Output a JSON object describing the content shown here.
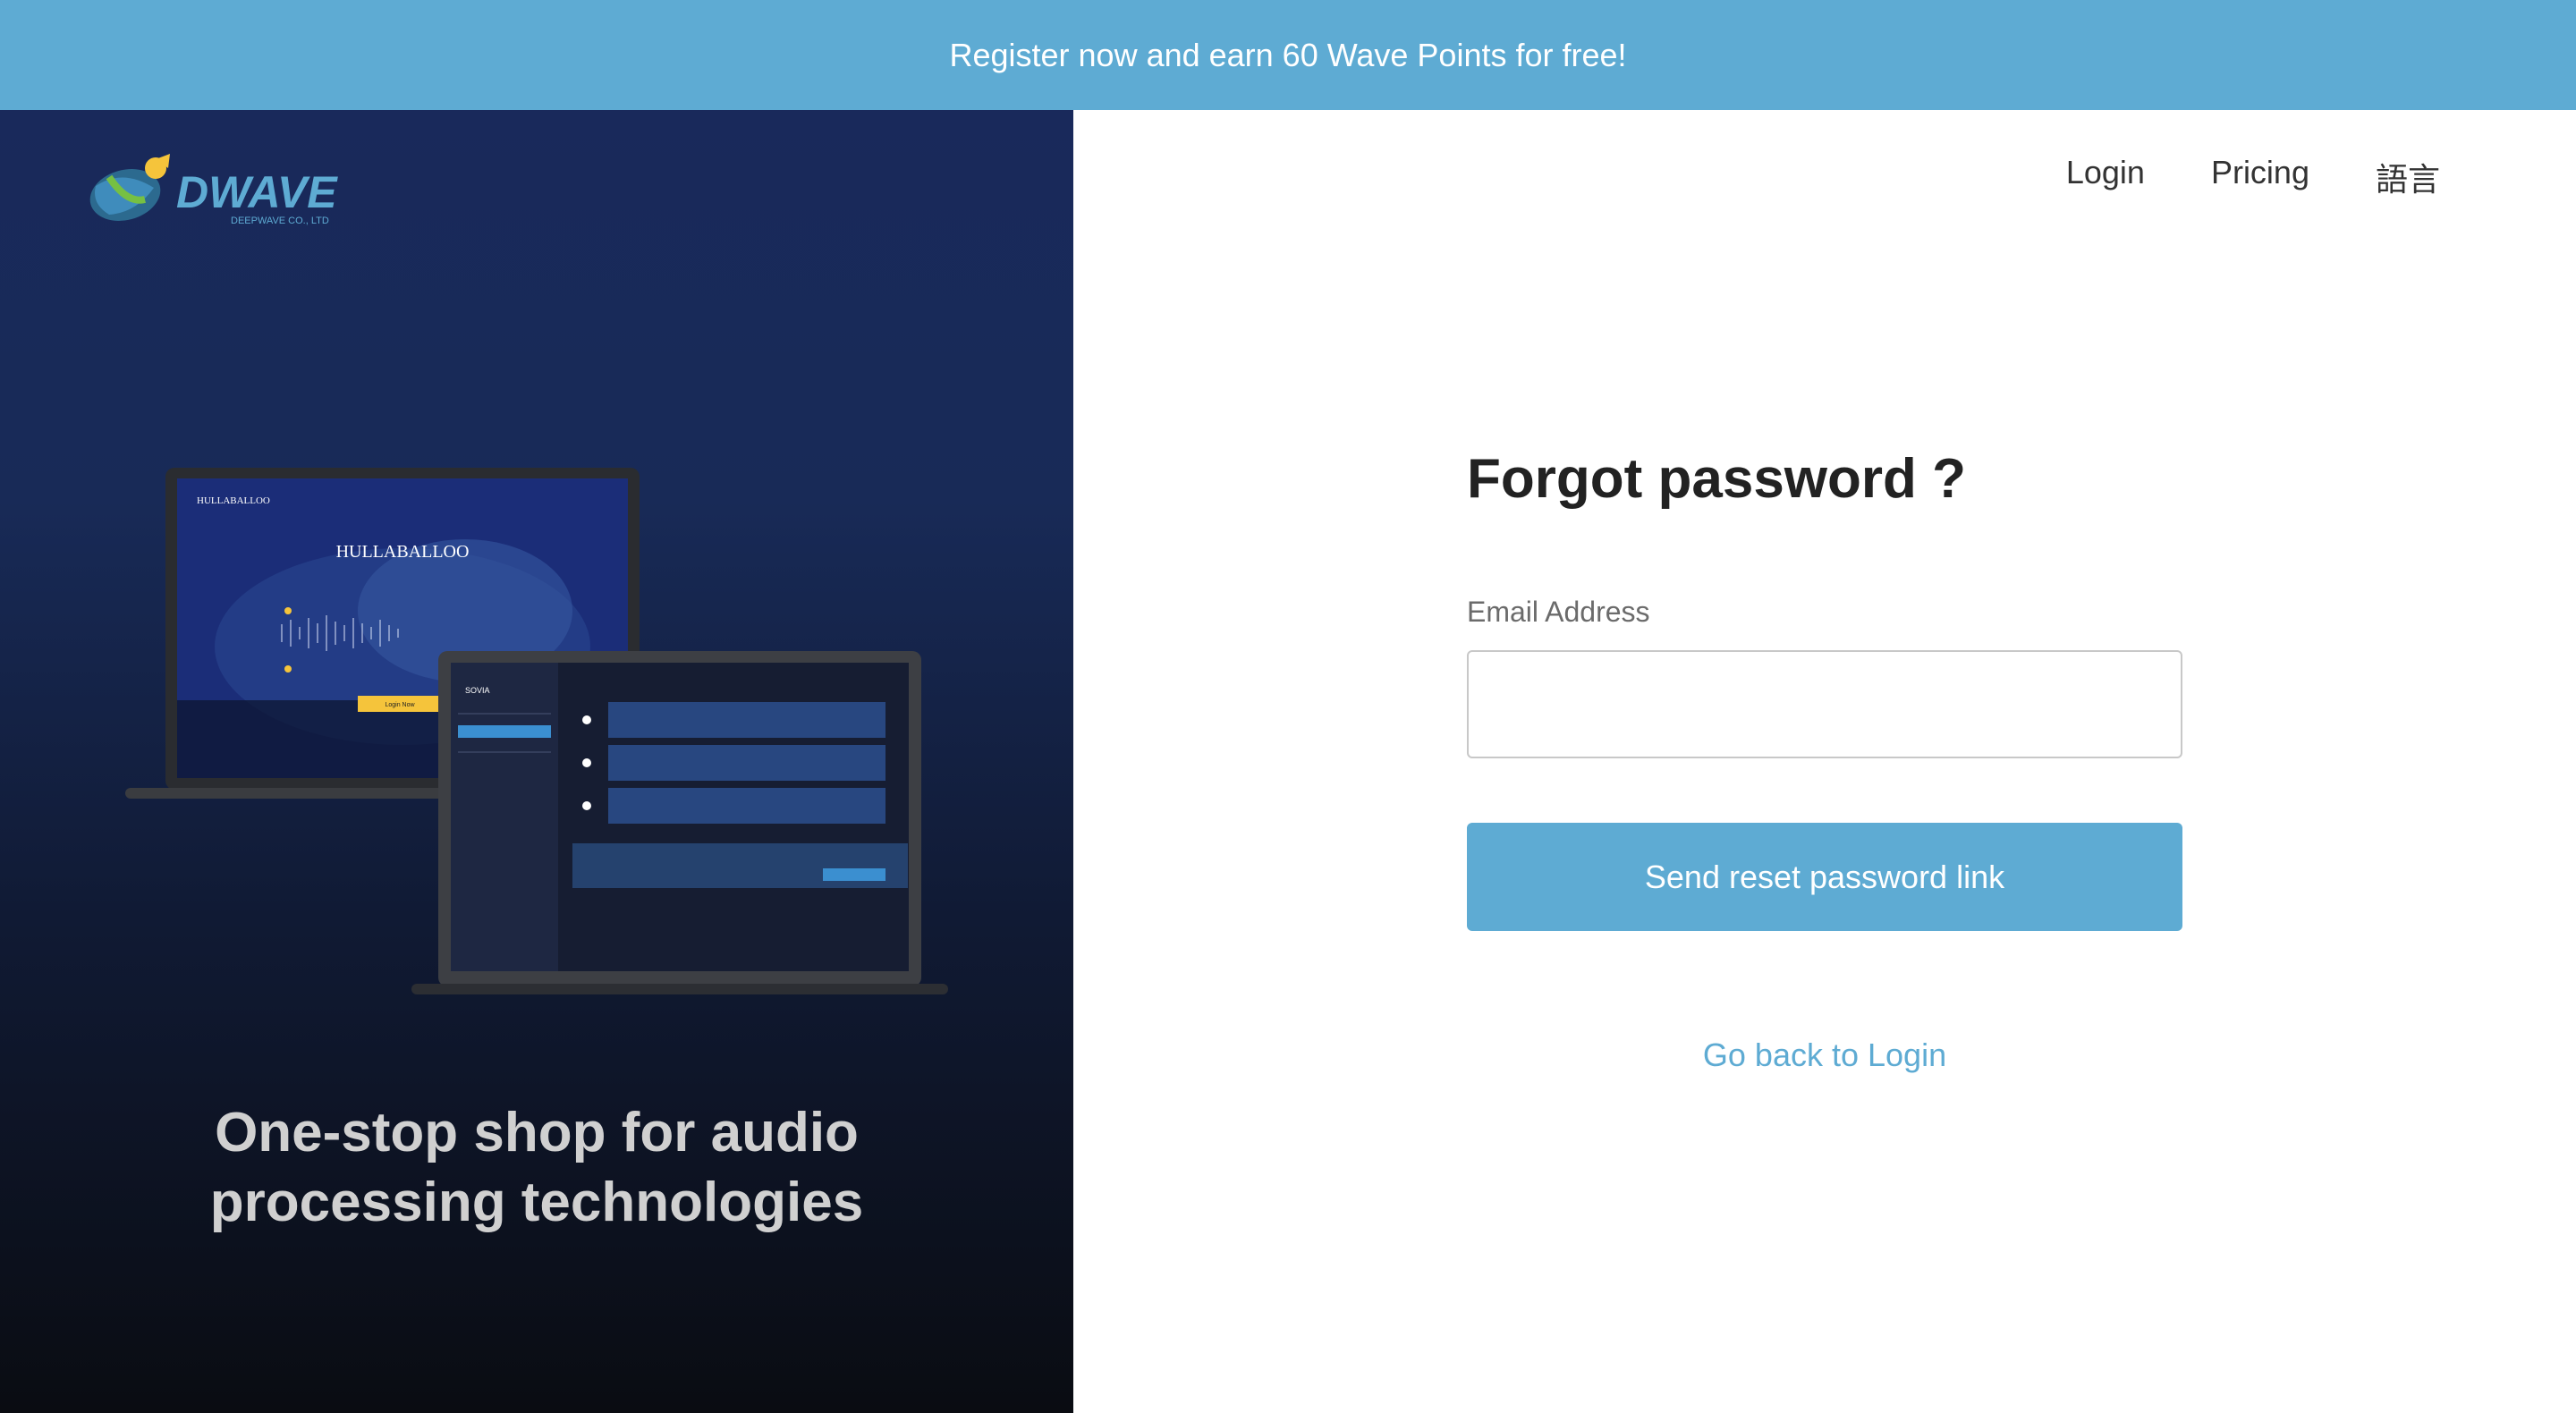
{
  "banner": {
    "text": "Register now and earn 60 Wave Points for free!"
  },
  "brand": {
    "name": "DWAVE",
    "subtitle": "DEEPWAVE CO., LTD"
  },
  "nav": {
    "login": "Login",
    "pricing": "Pricing",
    "language": "語言"
  },
  "promo": {
    "tagline_line1": "One-stop shop for audio",
    "tagline_line2": "processing technologies",
    "laptop_title": "HULLABALLOO",
    "laptop_brand": "HULLABALLOO",
    "laptop_button": "Login Now",
    "tablet_brand": "SOVIA"
  },
  "form": {
    "title": "Forgot password ?",
    "email_label": "Email Address",
    "email_value": "",
    "email_placeholder": "",
    "submit_label": "Send reset password link",
    "back_link": "Go back to Login"
  },
  "colors": {
    "accent": "#5eabd3",
    "left_panel_top": "#19295b",
    "left_panel_bottom": "#0a0c12",
    "text_dark": "#222222"
  }
}
